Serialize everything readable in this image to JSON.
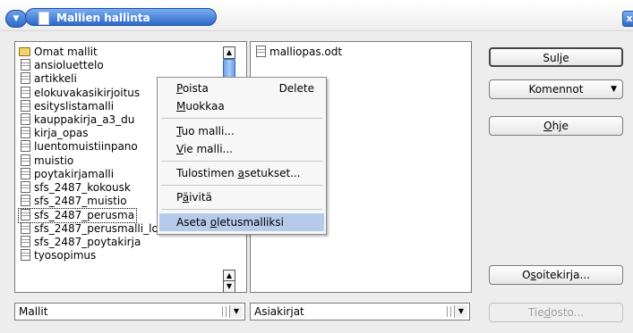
{
  "window": {
    "title": "Mallien hallinta",
    "close_label": "x"
  },
  "tree": {
    "items": [
      {
        "label": "Omat mallit",
        "kind": "folder"
      },
      {
        "label": "ansioluettelo",
        "kind": "file"
      },
      {
        "label": "artikkeli",
        "kind": "file"
      },
      {
        "label": "elokuvakasikirjoitus",
        "kind": "file"
      },
      {
        "label": "esityslistamalli",
        "kind": "file"
      },
      {
        "label": "kauppakirja_a3_du",
        "kind": "file"
      },
      {
        "label": "kirja_opas",
        "kind": "file"
      },
      {
        "label": "luentomuistiinpano",
        "kind": "file"
      },
      {
        "label": "muistio",
        "kind": "file"
      },
      {
        "label": "poytakirjamalli",
        "kind": "file"
      },
      {
        "label": "sfs_2487_kokousk",
        "kind": "file"
      },
      {
        "label": "sfs_2487_muistio",
        "kind": "file"
      },
      {
        "label": "sfs_2487_perusma",
        "kind": "file",
        "selected": true
      },
      {
        "label": "sfs_2487_perusmalli_lomake",
        "kind": "file"
      },
      {
        "label": "sfs_2487_poytakirja",
        "kind": "file"
      },
      {
        "label": "tyosopimus",
        "kind": "file"
      }
    ],
    "scroll_up": "▲",
    "scroll_down": "▼"
  },
  "files": {
    "items": [
      {
        "label": "malliopas.odt"
      }
    ]
  },
  "context_menu": {
    "items": [
      {
        "label_pre": "",
        "accel": "P",
        "label_post": "oista",
        "shortcut": "Delete"
      },
      {
        "label_pre": "",
        "accel": "M",
        "label_post": "uokkaa",
        "shortcut": ""
      },
      {
        "label_pre": "",
        "accel": "T",
        "label_post": "uo malli...",
        "shortcut": ""
      },
      {
        "label_pre": "",
        "accel": "V",
        "label_post": "ie malli...",
        "shortcut": ""
      },
      {
        "label_pre": "Tulostimen ",
        "accel": "a",
        "label_post": "setukset...",
        "shortcut": ""
      },
      {
        "label_pre": "P",
        "accel": "ä",
        "label_post": "ivitä",
        "shortcut": ""
      },
      {
        "label_pre": "Aseta ",
        "accel": "o",
        "label_post": "letusmalliksi",
        "shortcut": "",
        "highlighted": true
      }
    ]
  },
  "buttons": {
    "close": "Sulje",
    "commands": "Komennot",
    "help_accel": "O",
    "help_rest": "hje",
    "address_pre": "O",
    "address_accel": "s",
    "address_post": "oitekirja...",
    "file_pre": "Tie",
    "file_accel": "d",
    "file_post": "osto..."
  },
  "combos": {
    "left_value": "Mallit",
    "right_value": "Asiakirjat"
  }
}
